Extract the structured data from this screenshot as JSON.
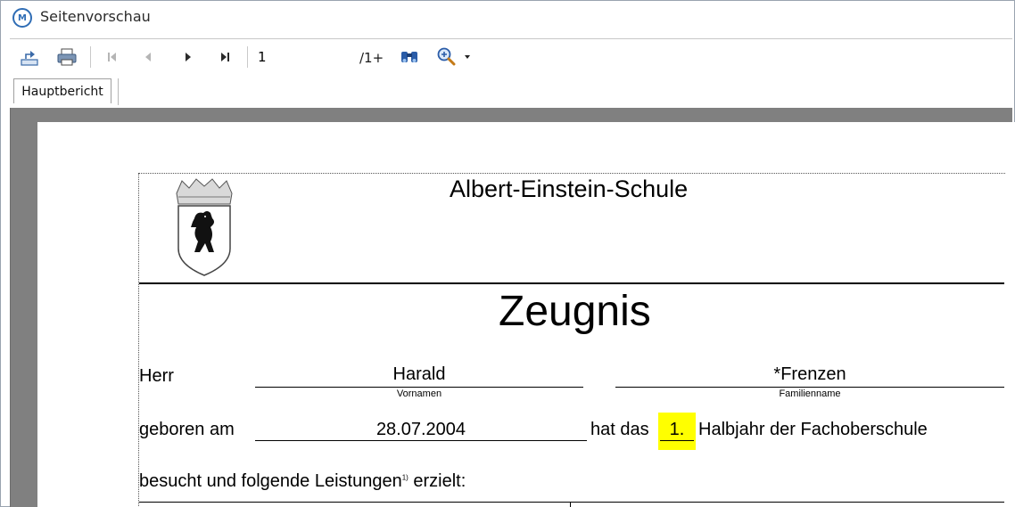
{
  "window": {
    "title": "Seitenvorschau",
    "app_icon": "m-logo-icon"
  },
  "toolbar": {
    "buttons": [
      "export-icon",
      "print-icon",
      "first-page-icon",
      "prev-page-icon",
      "next-page-icon",
      "last-page-icon",
      "find-icon",
      "zoom-icon"
    ],
    "page_value": "1",
    "page_total": "/1+"
  },
  "tabs": [
    {
      "label": "Hauptbericht",
      "selected": true
    }
  ],
  "report": {
    "school_name": "Albert-Einstein-Schule",
    "title": "Zeugnis",
    "salutation": "Herr",
    "first_name": "Harald",
    "first_name_caption": "Vornamen",
    "last_name": "*Frenzen",
    "last_name_caption": "Familienname",
    "born_label": "geboren am",
    "birth_date": "28.07.2004",
    "has_the": "hat das",
    "half_year": "1.",
    "half_year_text": "Halbjahr der Fachoberschule",
    "attended_text": "besucht und folgende Leistungen",
    "footnote_mark": "1)",
    "achieved": "erzielt:",
    "highlight_color": "#ffff00"
  }
}
